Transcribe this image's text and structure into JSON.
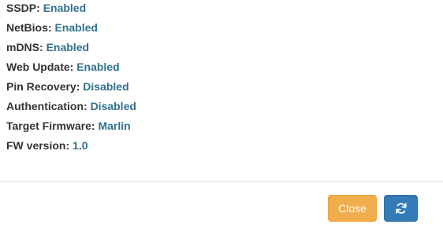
{
  "status_items": [
    {
      "label": "SSDP",
      "value": "Enabled"
    },
    {
      "label": "NetBios",
      "value": "Enabled"
    },
    {
      "label": "mDNS",
      "value": "Enabled"
    },
    {
      "label": "Web Update",
      "value": "Enabled"
    },
    {
      "label": "Pin Recovery",
      "value": "Disabled"
    },
    {
      "label": "Authentication",
      "value": "Disabled"
    },
    {
      "label": "Target Firmware",
      "value": "Marlin"
    },
    {
      "label": "FW version",
      "value": "1.0"
    }
  ],
  "separator": ": ",
  "footer": {
    "close_label": "Close",
    "refresh_icon": "refresh-icon"
  },
  "colors": {
    "label": "#333333",
    "value": "#31708f",
    "close_button": "#f0ad4e",
    "refresh_button": "#337ab7"
  }
}
